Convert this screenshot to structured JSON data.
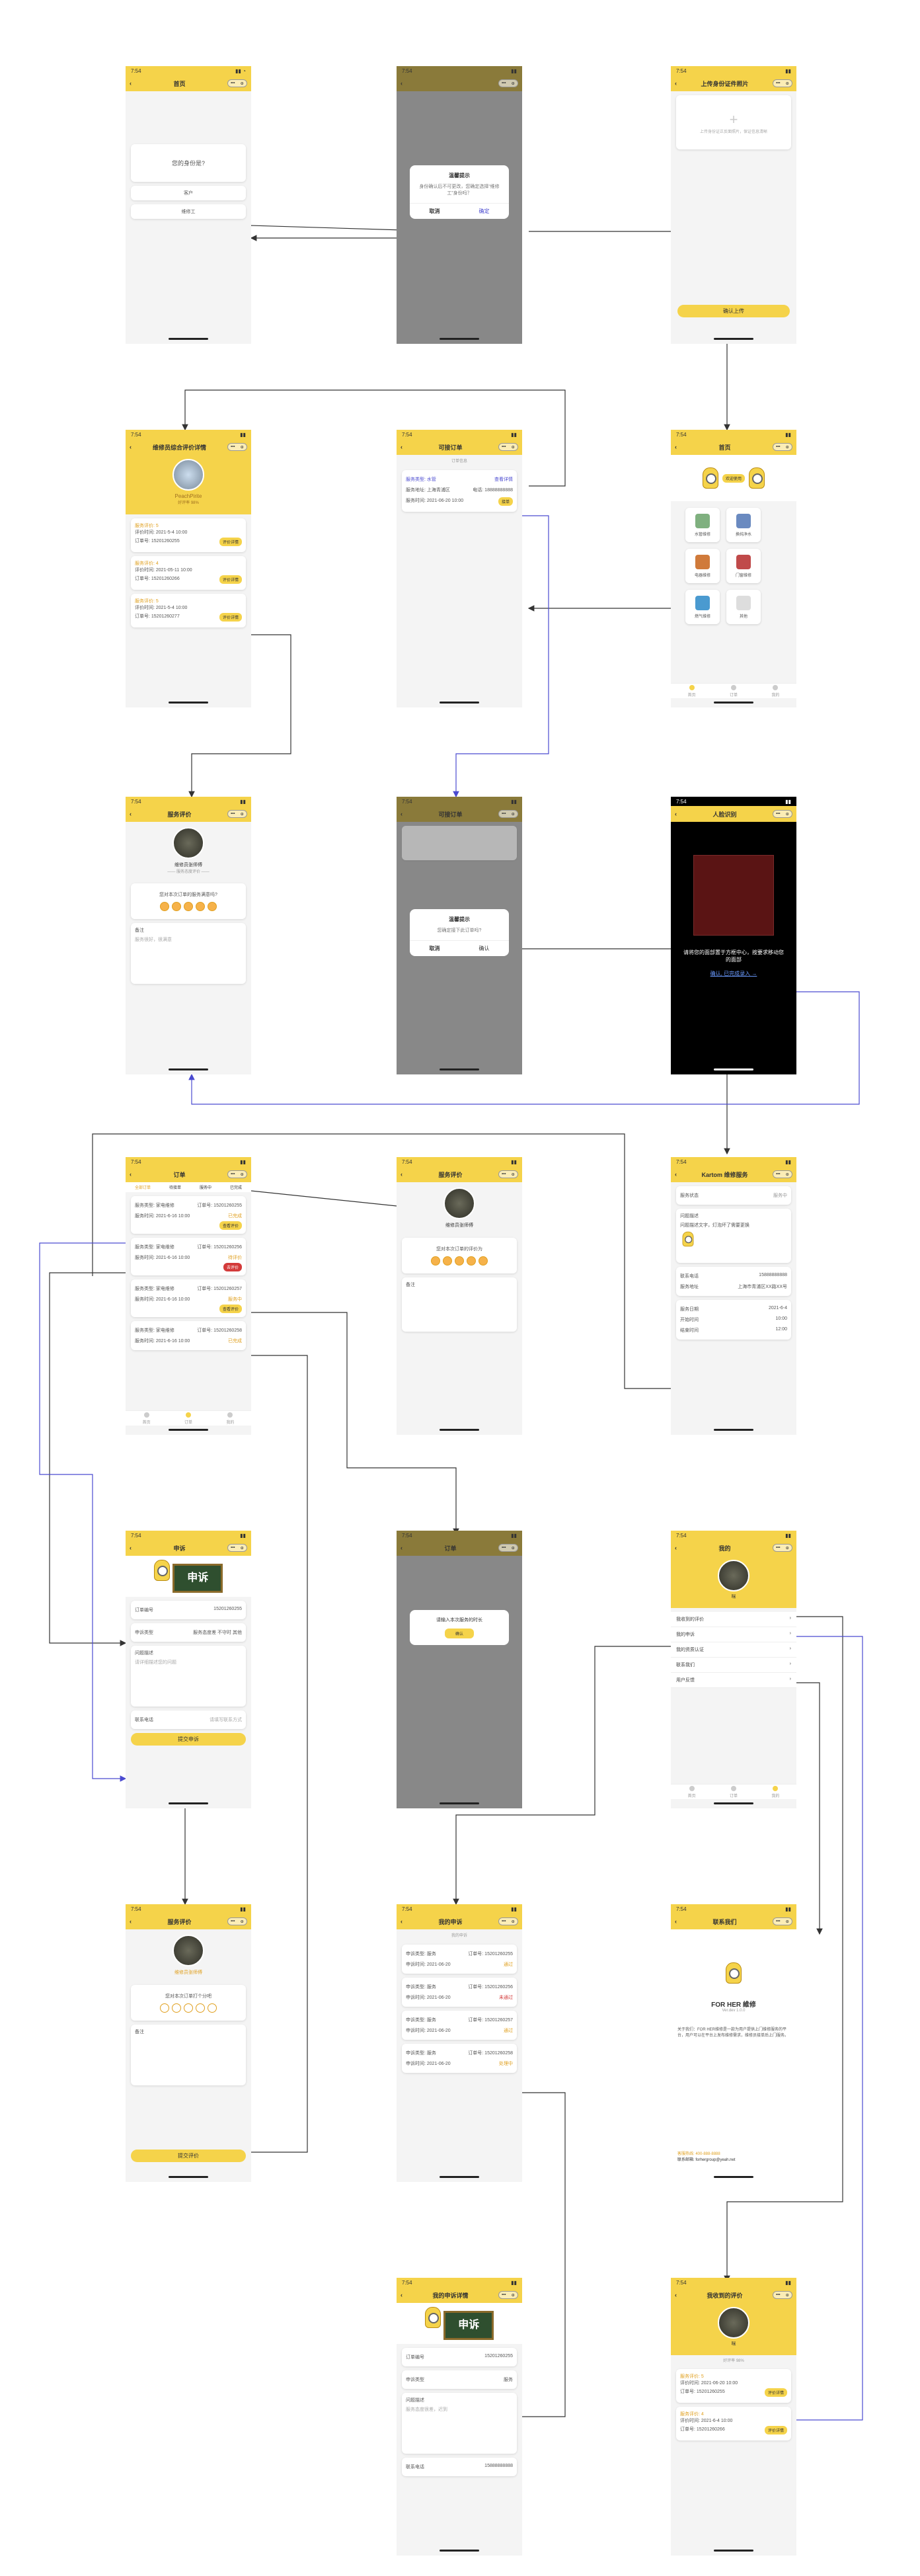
{
  "colors": {
    "accent": "#f5d34a",
    "arrow_black": "#333333",
    "arrow_blue": "#4a4ad0",
    "danger": "#d33a3a"
  },
  "common": {
    "time": "7:54",
    "back_icon": "‹",
    "more_icon": "•••",
    "close_icon": "⊙"
  },
  "s1": {
    "title": "首页",
    "question": "您的身份是?",
    "opt1": "客户",
    "opt2": "维修工"
  },
  "s2": {
    "dialog_title": "温馨提示",
    "dialog_text": "身份确认后不可更改，您确定选择“维修工”身份吗？",
    "cancel": "取消",
    "confirm": "确定"
  },
  "s3": {
    "title": "上传身份证件照片",
    "upload_hint": "上传身份证正反面照片，保证信息清晰",
    "btn": "确认上传"
  },
  "s4": {
    "title": "首页",
    "banner_text": "欢迎使用",
    "services": [
      "水管维修",
      "换纯净水",
      "电器维修",
      "门窗维修",
      "燃气维修",
      "其他"
    ],
    "tabs": [
      "首页",
      "订单",
      "我的"
    ]
  },
  "s5": {
    "title": "可接订单",
    "header": "订单信息",
    "type_label": "服务类型: 水管",
    "detail": "查看详情",
    "addr_label": "服务地址: 上海青浦区",
    "tel_label": "电话: 18888888888",
    "time_label": "服务时间: 2021-06-20 10:00",
    "btn": "接单"
  },
  "s6": {
    "title": "维修员综合评价详情",
    "name": "PeachPirite",
    "subtitle": "好评率 98%",
    "cards": [
      {
        "title": "服务评价: 5",
        "t1": "评价时间: 2021-5-4 10:00",
        "t2": "订单号: 15201260255",
        "btn": "评价详情"
      },
      {
        "title": "服务评价: 4",
        "t1": "评价时间: 2021-05-11 10:00",
        "t2": "订单号: 15201260266",
        "btn": "评价详情"
      },
      {
        "title": "服务评价: 5",
        "t1": "评价时间: 2021-5-4 10:00",
        "t2": "订单号: 15201260277",
        "btn": "评价详情"
      }
    ]
  },
  "s7": {
    "title": "服务评价",
    "name": "维修员张师傅",
    "sub": "—— 服务态度评价 ——",
    "q": "您对本次订单的服务满意吗?",
    "remark": "备注",
    "remark_ph": "服务很好，很满意"
  },
  "s8": {
    "title": "可接订单",
    "dialog_title": "温馨提示",
    "dialog_text": "您确定接下此订单吗?",
    "cancel": "取消",
    "confirm": "确认"
  },
  "s9": {
    "title": "人脸识别",
    "hint": "请将您的面部置于方框中心，按要求移动您的面部",
    "link": "确认, 已完成录入 →"
  },
  "s10": {
    "title": "订单",
    "tabs": [
      "全部订单",
      "待接单",
      "服务中",
      "已完成"
    ],
    "rows": [
      {
        "t": "服务类型: 家电维修",
        "no": "订单号: 15201260255",
        "time": "服务时间: 2021-6-16 10:00",
        "status": "已完成",
        "btn": "查看评价"
      },
      {
        "t": "服务类型: 家电维修",
        "no": "订单号: 15201260256",
        "time": "服务时间: 2021-6-16 10:00",
        "status": "待评价",
        "btn": "去评价"
      },
      {
        "t": "服务类型: 家电维修",
        "no": "订单号: 15201260257",
        "time": "服务时间: 2021-6-16 10:00",
        "status": "服务中",
        "btn": "查看评价"
      },
      {
        "t": "服务类型: 家电维修",
        "no": "订单号: 15201260258",
        "time": "服务时间: 2021-6-16 10:00",
        "status": "已完成",
        "btn": "查看评价"
      }
    ]
  },
  "s11": {
    "title": "服务评价",
    "name": "维修员张师傅",
    "q": "您对本次订单的评价为",
    "remark": "备注"
  },
  "s12": {
    "title": "Kartom 维修服务",
    "rows": [
      {
        "k": "服务状态",
        "v": "服务中"
      },
      {
        "k": "问题描述",
        "v": "问题描述文字，灯泡坏了需要更换"
      },
      {
        "k": "联系电话",
        "v": "15888888888"
      },
      {
        "k": "服务地址",
        "v": "上海市青浦区XX路XX号"
      },
      {
        "k": "服务日期",
        "v": "2021-6-4"
      },
      {
        "k": "开始时间",
        "v": "10:00"
      },
      {
        "k": "结束时间",
        "v": "12:00"
      }
    ]
  },
  "s13": {
    "title": "申诉",
    "board": "申诉",
    "rows": [
      {
        "k": "订单编号",
        "v": "15201260255"
      },
      {
        "k": "申诉类型",
        "v": "服务态度差 不守时 其他"
      },
      {
        "k": "问题描述",
        "v": "请详细描述您的问题"
      },
      {
        "k": "联系电话",
        "v": "请填写联系方式"
      }
    ],
    "btn": "提交申诉"
  },
  "s14": {
    "title": "订单",
    "dialog_text": "请输入本次服务的时长",
    "btn": "确认"
  },
  "s15": {
    "title": "我的",
    "name": "咪",
    "menu": [
      "我收到的评价",
      "我的申诉",
      "我的资质认证",
      "联系我们",
      "用户反馈"
    ]
  },
  "s16": {
    "title": "服务评价",
    "name": "维修员张师傅",
    "q": "您对本次订单打个分吧",
    "remark": "备注",
    "btn": "提交评价"
  },
  "s17": {
    "title": "我的申诉",
    "header": "我的申诉",
    "rows": [
      {
        "t": "申诉类型: 服务",
        "no": "订单号: 15201260255",
        "time": "申诉时间: 2021-06-20",
        "status": "通过"
      },
      {
        "t": "申诉类型: 服务",
        "no": "订单号: 15201260256",
        "time": "申诉时间: 2021-06-20",
        "status": "未通过"
      },
      {
        "t": "申诉类型: 服务",
        "no": "订单号: 15201260257",
        "time": "申诉时间: 2021-06-20",
        "status": "通过"
      },
      {
        "t": "申诉类型: 服务",
        "no": "订单号: 15201260258",
        "time": "申诉时间: 2021-06-20",
        "status": "处理中"
      }
    ]
  },
  "s18": {
    "title": "联系我们",
    "brand": "FOR HER 維修",
    "sub": "Ver.dev 1.0.0",
    "about": "关于我们：FOR HER维修是一款为用户提供上门维修服务的平台，用户可以在平台上发布维修需求，维修员接单后上门服务。",
    "tel": "客服热线: 400-888-8888",
    "email": "联系邮箱: forhergroup@yeah.net"
  },
  "s19": {
    "title": "我的申诉详情",
    "board": "申诉",
    "rows": [
      {
        "k": "订单编号",
        "v": "15201260255"
      },
      {
        "k": "申诉类型",
        "v": "服务"
      },
      {
        "k": "问题描述",
        "v": "服务态度很差，迟到"
      },
      {
        "k": "联系电话",
        "v": "15888888888"
      }
    ]
  },
  "s20": {
    "title": "我收到的评价",
    "name": "咪",
    "sub": "好评率 98%",
    "cards": [
      {
        "title": "服务评价: 5",
        "t1": "评价时间: 2021-06-20 10:00",
        "t2": "订单号: 15201260255",
        "btn": "评价详情"
      },
      {
        "title": "服务评价: 4",
        "t1": "评价时间: 2021-6-4 10:00",
        "t2": "订单号: 15201260266",
        "btn": "评价详情"
      }
    ]
  }
}
